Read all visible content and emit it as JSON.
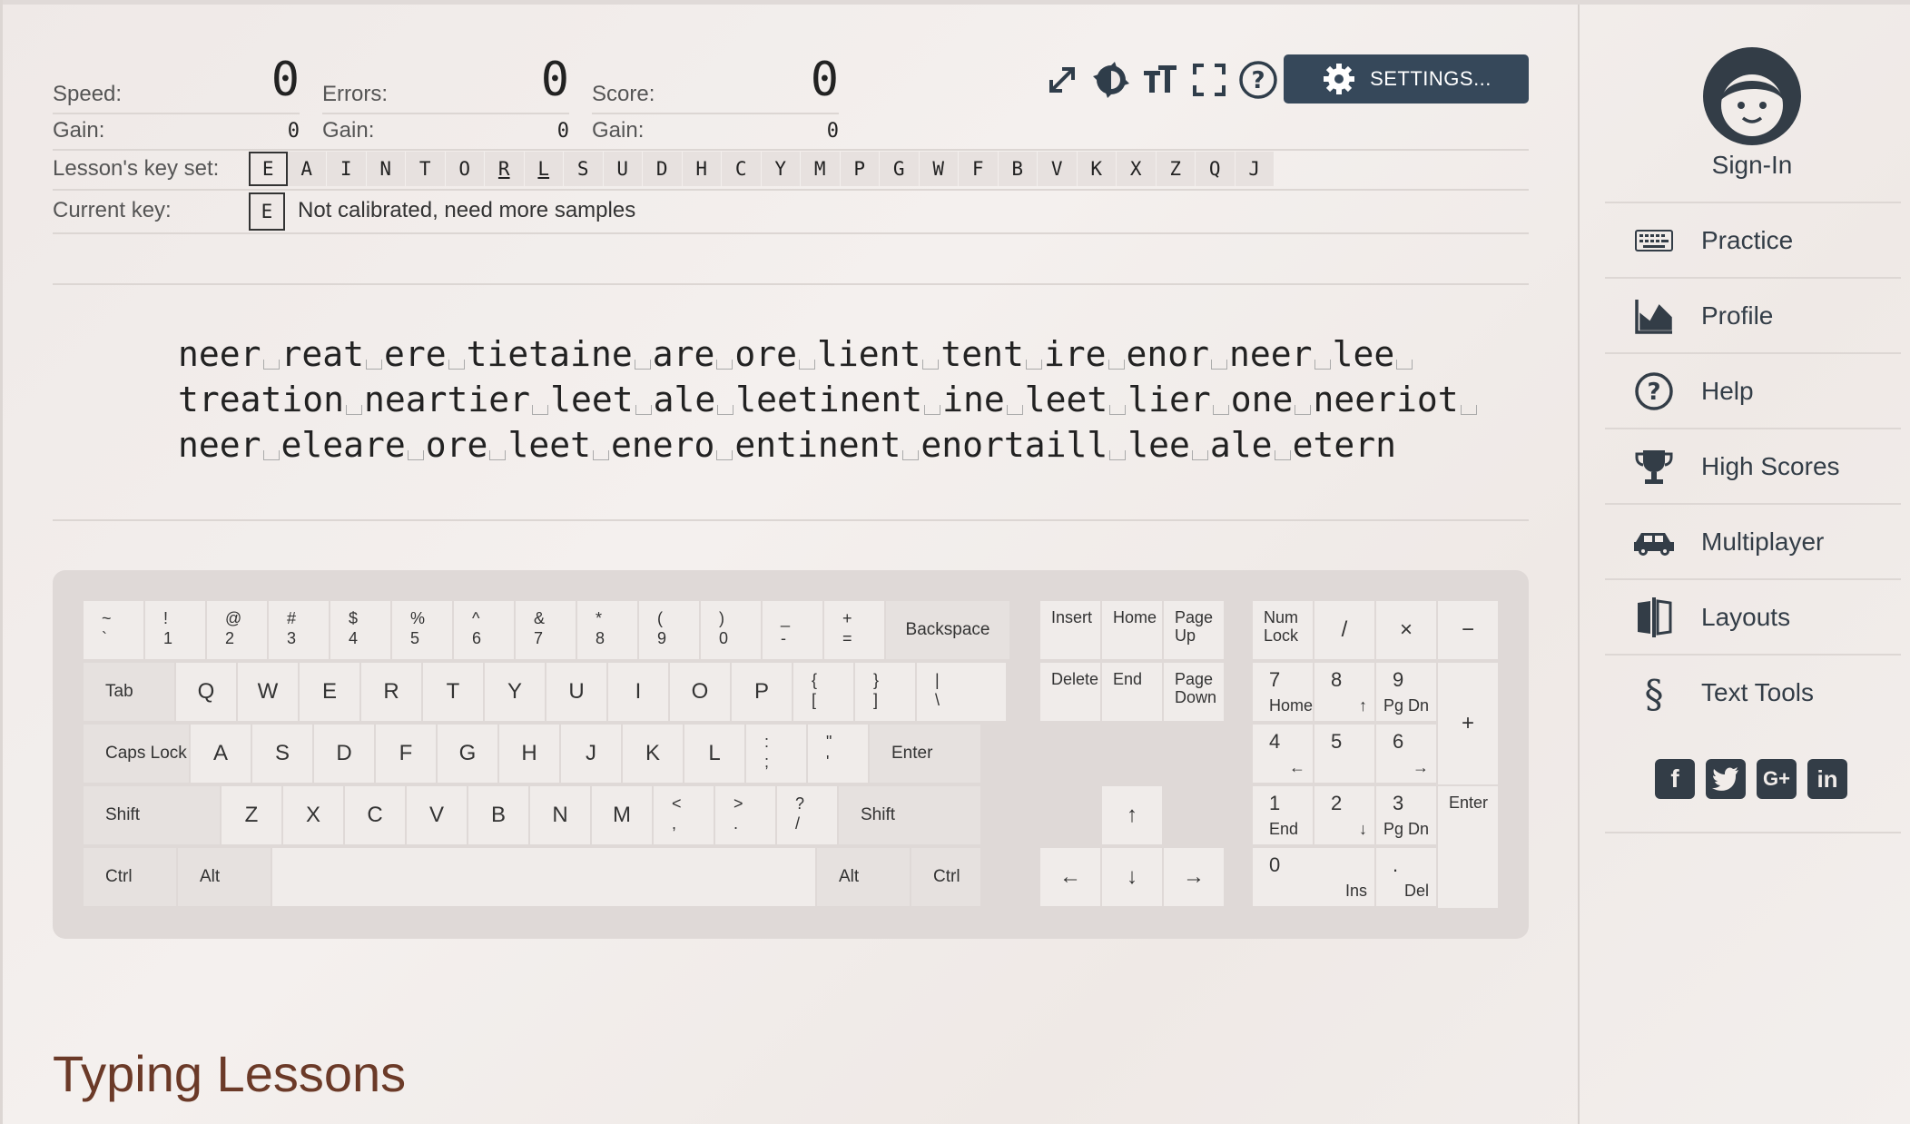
{
  "stats": {
    "speed_label": "Speed:",
    "speed_value": "0",
    "speed_gain_label": "Gain:",
    "speed_gain": "0",
    "errors_label": "Errors:",
    "errors_value": "0",
    "errors_gain_label": "Gain:",
    "errors_gain": "0",
    "score_label": "Score:",
    "score_value": "0",
    "score_gain_label": "Gain:",
    "score_gain": "0"
  },
  "toolbar": {
    "icons": [
      "expand-icon",
      "theme-icon",
      "font-size-icon",
      "fullscreen-icon",
      "help-icon"
    ],
    "settings_label": "SETTINGS..."
  },
  "keyset": {
    "label": "Lesson's key set:",
    "keys": [
      "E",
      "A",
      "I",
      "N",
      "T",
      "O",
      "R",
      "L",
      "S",
      "U",
      "D",
      "H",
      "C",
      "Y",
      "M",
      "P",
      "G",
      "W",
      "F",
      "B",
      "V",
      "K",
      "X",
      "Z",
      "Q",
      "J"
    ],
    "current_index": 0,
    "underlined": [
      "R",
      "L"
    ]
  },
  "current_key": {
    "label": "Current key:",
    "key": "E",
    "status": "Not calibrated, need more samples"
  },
  "lesson_lines": [
    [
      "neer",
      "reat",
      "ere",
      "tietaine",
      "are",
      "ore",
      "lient",
      "tent",
      "ire",
      "enor",
      "neer",
      "lee",
      ""
    ],
    [
      "treation",
      "neartier",
      "leet",
      "ale",
      "leetinent",
      "ine",
      "leet",
      "lier",
      "one",
      "neeriot",
      ""
    ],
    [
      "neer",
      "eleare",
      "ore",
      "leet",
      "enero",
      "entinent",
      "enortaill",
      "lee",
      "ale",
      "etern"
    ]
  ],
  "keyboard": {
    "row1": [
      [
        "~",
        "`"
      ],
      [
        "!",
        "1"
      ],
      [
        "@",
        "2"
      ],
      [
        "#",
        "3"
      ],
      [
        "$",
        "4"
      ],
      [
        "%",
        "5"
      ],
      [
        "^",
        "6"
      ],
      [
        "&",
        "7"
      ],
      [
        "*",
        "8"
      ],
      [
        "(",
        "9"
      ],
      [
        ")",
        "0"
      ],
      [
        "_",
        "-"
      ],
      [
        "+",
        "="
      ]
    ],
    "backspace": "Backspace",
    "tab": "Tab",
    "row2": [
      "Q",
      "W",
      "E",
      "R",
      "T",
      "Y",
      "U",
      "I",
      "O",
      "P"
    ],
    "row2_sym": [
      [
        "{",
        "["
      ],
      [
        "}",
        "]"
      ],
      [
        "|",
        "\\"
      ]
    ],
    "caps": "Caps Lock",
    "row3": [
      "A",
      "S",
      "D",
      "F",
      "G",
      "H",
      "J",
      "K",
      "L"
    ],
    "row3_sym": [
      [
        ":",
        ";"
      ],
      [
        "\"",
        "'"
      ]
    ],
    "enter": "Enter",
    "shift_left": "Shift",
    "row4": [
      "Z",
      "X",
      "C",
      "V",
      "B",
      "N",
      "M"
    ],
    "row4_sym": [
      [
        "<",
        ","
      ],
      [
        ">",
        "."
      ],
      [
        "?",
        "/"
      ]
    ],
    "shift_right": "Shift",
    "ctrl_left": "Ctrl",
    "alt_left": "Alt",
    "alt_right": "Alt",
    "ctrl_right": "Ctrl",
    "nav": {
      "insert": "Insert",
      "home": "Home",
      "page_up": "Page Up",
      "delete": "Delete",
      "end": "End",
      "page_down": "Page Down"
    },
    "arrows": {
      "up": "↑",
      "left": "←",
      "down": "↓",
      "right": "→"
    },
    "numpad": {
      "numlock": "Num Lock",
      "slash": "/",
      "times": "×",
      "minus": "−",
      "plus": "+",
      "enter": "Enter",
      "n7": "7",
      "n7s": "Home",
      "n8": "8",
      "n8s": "↑",
      "n9": "9",
      "n9s": "Pg Dn",
      "n4": "4",
      "n4s": "←",
      "n5": "5",
      "n6": "6",
      "n6s": "→",
      "n1": "1",
      "n1s": "End",
      "n2": "2",
      "n2s": "↓",
      "n3": "3",
      "n3s": "Pg Dn",
      "n0": "0",
      "n0s": "Ins",
      "dot": ".",
      "dots": "Del"
    }
  },
  "heading": "Typing Lessons",
  "sidebar": {
    "signin": "Sign-In",
    "items": [
      {
        "label": "Practice",
        "icon": "keyboard-icon"
      },
      {
        "label": "Profile",
        "icon": "chart-icon"
      },
      {
        "label": "Help",
        "icon": "help-icon"
      },
      {
        "label": "High Scores",
        "icon": "trophy-icon"
      },
      {
        "label": "Multiplayer",
        "icon": "car-icon"
      },
      {
        "label": "Layouts",
        "icon": "layouts-icon"
      },
      {
        "label": "Text Tools",
        "icon": "section-icon"
      }
    ],
    "social": [
      "facebook-icon",
      "twitter-icon",
      "google-plus-icon",
      "linkedin-icon"
    ]
  },
  "colors": {
    "accent": "#36485a",
    "heading": "#6b3a28",
    "sidebar_icon": "#333d47"
  }
}
